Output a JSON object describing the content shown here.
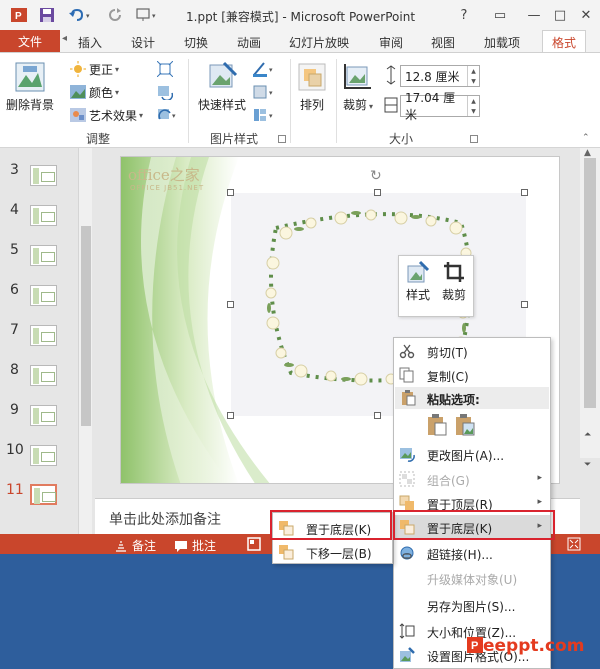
{
  "app": {
    "title": "1.ppt [兼容模式] - Microsoft PowerPoint"
  },
  "window_controls": {
    "help": "?",
    "restore": "▭",
    "minimize": "—",
    "maximize": "□",
    "close": "✕"
  },
  "tabs": {
    "file": "文件",
    "items": [
      "插入",
      "设计",
      "切换",
      "动画",
      "幻灯片放映",
      "审阅",
      "视图",
      "加载项"
    ],
    "active": "格式"
  },
  "ribbon": {
    "remove_bg": "删除背景",
    "corrections": "更正",
    "color": "颜色",
    "artistic": "艺术效果",
    "quick_styles": "快速样式",
    "arrange": "排列",
    "crop": "裁剪",
    "height": "12.8 厘米",
    "width": "17.04 厘米",
    "group_adjust": "调整",
    "group_picture_styles": "图片样式",
    "group_size": "大小"
  },
  "slides": {
    "numbers": [
      "3",
      "4",
      "5",
      "6",
      "7",
      "8",
      "9",
      "10",
      "11"
    ],
    "selected": "11"
  },
  "slide": {
    "logo": "office之家",
    "logo_sub": "OFFICE JB51.NET"
  },
  "mini_toolbar": {
    "style": "样式",
    "crop": "裁剪"
  },
  "notes_placeholder": "单击此处添加备注",
  "status": {
    "notes": "备注",
    "comments": "批注"
  },
  "context_menu": {
    "cut": "剪切(T)",
    "copy": "复制(C)",
    "paste_options": "粘贴选项:",
    "change_picture": "更改图片(A)...",
    "group": "组合(G)",
    "bring_to_front": "置于顶层(R)",
    "send_to_back": "置于底层(K)",
    "hyperlink": "超链接(H)...",
    "upgrade_media": "升级媒体对象(U)",
    "save_as_picture": "另存为图片(S)...",
    "size_position": "大小和位置(Z)...",
    "format_picture": "设置图片格式(O)..."
  },
  "submenu": {
    "send_to_back": "置于底层(K)",
    "send_backward": "下移一层(B)"
  },
  "watermark": "eeppt.com",
  "colors": {
    "accent": "#c9462c",
    "highlight_box": "#d9232e",
    "desktop": "#2e5e9c"
  }
}
